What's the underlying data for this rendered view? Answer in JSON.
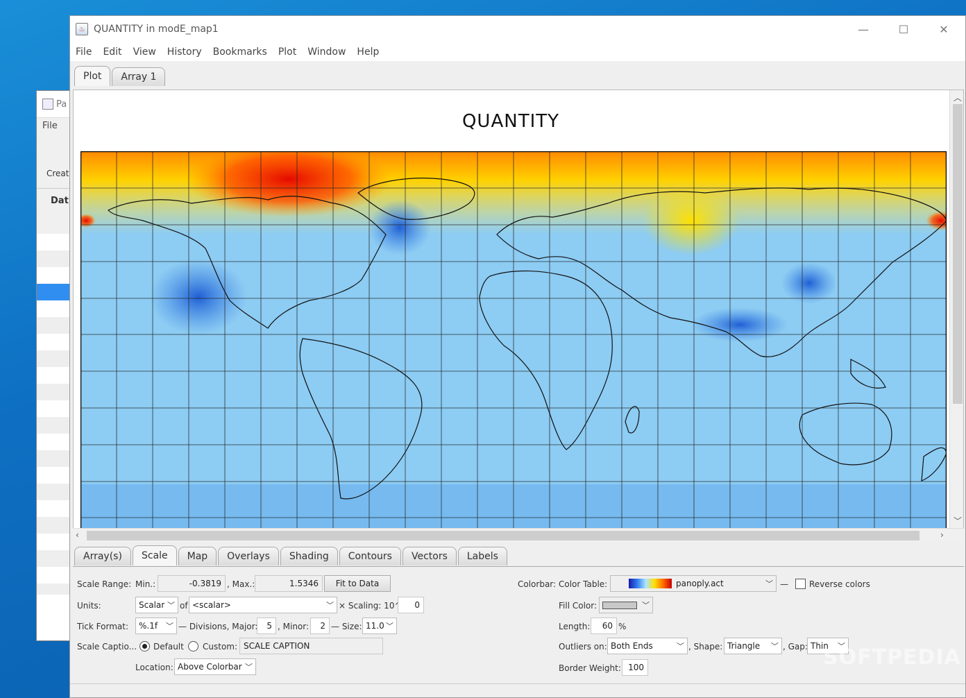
{
  "bg_window": {
    "title": "Pa",
    "menu_file": "File",
    "tool_label": "Creat",
    "tab_label": "Dat"
  },
  "window": {
    "title": "QUANTITY in modE_map1",
    "minimize": "—",
    "maximize": "☐",
    "close": "✕"
  },
  "menubar": [
    "File",
    "Edit",
    "View",
    "History",
    "Bookmarks",
    "Plot",
    "Window",
    "Help"
  ],
  "top_tabs": [
    "Plot",
    "Array 1"
  ],
  "plot": {
    "title": "QUANTITY"
  },
  "bottom_tabs": [
    "Array(s)",
    "Scale",
    "Map",
    "Overlays",
    "Shading",
    "Contours",
    "Vectors",
    "Labels"
  ],
  "scale": {
    "range_label": "Scale Range:",
    "min_label": "Min.:",
    "min_value": "-0.3819",
    "max_label": ", Max.:",
    "max_value": "1.5346",
    "fit_button": "Fit to Data",
    "units_label": "Units:",
    "units_value": "Scalar",
    "of_label": "of",
    "scalar_value": "<scalar>",
    "scaling_label": "× Scaling: 10^",
    "scaling_value": "0",
    "tick_label": "Tick Format:",
    "tick_value": "%.1f",
    "divisions_label": "— Divisions, Major:",
    "major_value": "5",
    "minor_label": ", Minor:",
    "minor_value": "2",
    "size_label": "— Size:",
    "size_value": "11.0",
    "caption_label": "Scale Captio...",
    "default_label": "Default",
    "custom_label": "Custom:",
    "caption_value": "SCALE CAPTION",
    "location_label": "Location:",
    "location_value": "Above Colorbar"
  },
  "colorbar": {
    "label": "Colorbar:",
    "table_label": "Color Table:",
    "table_value": "panoply.act",
    "dash": "—",
    "reverse_label": "Reverse colors",
    "fill_label": "Fill Color:",
    "fill_color": "#c8c8c8",
    "length_label": "Length:",
    "length_value": "60",
    "percent": "%",
    "outliers_label": "Outliers on:",
    "outliers_value": "Both Ends",
    "shape_label": ", Shape:",
    "shape_value": "Triangle",
    "gap_label": ", Gap:",
    "gap_value": "Thin",
    "border_label": "Border Weight:",
    "border_value": "100"
  },
  "watermark": "SOFTPEDIA",
  "colors": {
    "map_base": "#8ccaf2",
    "hot": "#e81e00",
    "warm": "#ffd400",
    "cool": "#2c6fd8"
  }
}
